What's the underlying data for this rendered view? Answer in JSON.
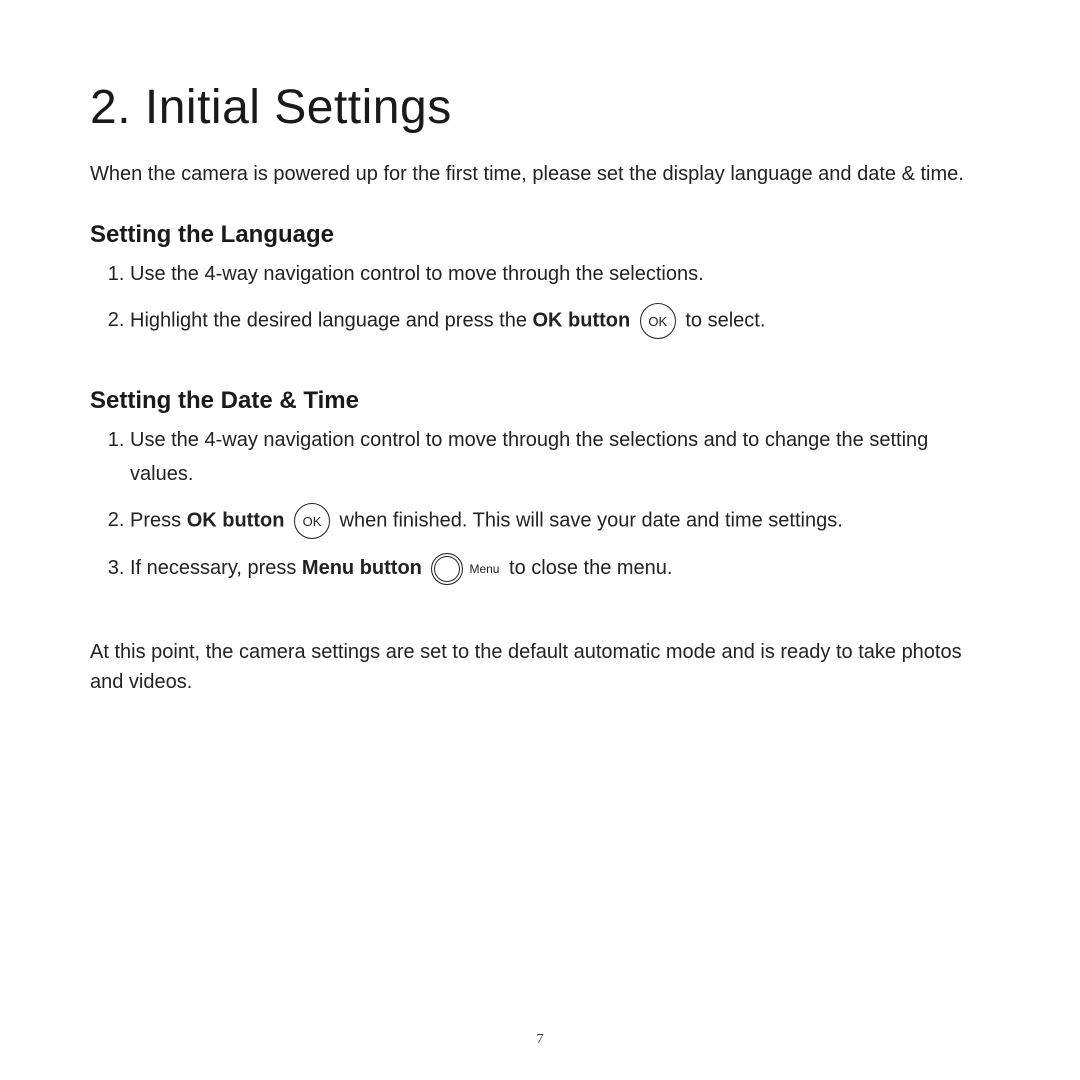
{
  "title": "2. Initial Settings",
  "intro": "When the camera is powered up for the first time, please set the display language and date & time.",
  "section1": {
    "heading": "Setting the Language",
    "step1": "Use the 4-way navigation control to move through the selections.",
    "step2_a": "Highlight the desired language and press the ",
    "step2_bold": "OK button",
    "step2_b": " to select.",
    "ok_label": "OK"
  },
  "section2": {
    "heading": "Setting the Date & Time",
    "step1": "Use the 4-way navigation control to move through the selections and to change the setting values.",
    "step2_a": "Press ",
    "step2_bold": "OK button",
    "step2_b": " when finished. This will save your date and time settings.",
    "step3_a": "If necessary, press ",
    "step3_bold": "Menu button",
    "step3_b": " to close the menu.",
    "ok_label": "OK",
    "menu_label": "Menu"
  },
  "closing": "At this point, the camera settings are set to the default automatic mode and is ready to take photos and videos.",
  "page_number": "7"
}
